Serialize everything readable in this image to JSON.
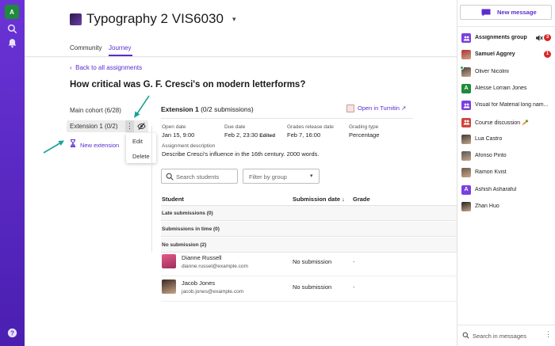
{
  "rail": {
    "avatar_letter": "A"
  },
  "course": {
    "title": "Typography 2 VIS6030"
  },
  "tabs": [
    {
      "label": "Community"
    },
    {
      "label": "Journey"
    }
  ],
  "back_link": "Back to all assignments",
  "question": "How critical was G. F. Cresci's on modern letterforms?",
  "left_panel": {
    "cohort": "Main cohort (6/28)",
    "extension": "Extension 1 (0/2)",
    "menu": {
      "edit": "Edit",
      "delete": "Delete"
    },
    "new_extension": "New extension"
  },
  "panel": {
    "title_bold": "Extension 1",
    "title_rest": " (0/2 submissions)",
    "turnitin": "Open in Turnitin",
    "open_date": {
      "label": "Open date",
      "value": "Jan 15, 9:00"
    },
    "due_date": {
      "label": "Due date",
      "value": "Feb 2, 23:30",
      "tag": "Edited"
    },
    "grades_release": {
      "label": "Grades release date",
      "value": "Feb 7, 16:00"
    },
    "grading_type": {
      "label": "Grading type",
      "value": "Percentage"
    },
    "description": {
      "label": "Assignment description",
      "value": "Describe Cresci's influence in the 16th century. 2000 words."
    },
    "search_placeholder": "Search students",
    "filter_placeholder": "Filter by group",
    "columns": {
      "student": "Student",
      "submission_date": "Submission date ↓",
      "grade": "Grade"
    },
    "sections": {
      "late": "Late submissions (0)",
      "on_time": "Submissions in time (0)",
      "none": "No submission (2)"
    },
    "students": [
      {
        "name": "Dianne Russell",
        "email": "dianne.russel@example.com",
        "status": "No submission",
        "grade": "-"
      },
      {
        "name": "Jacob Jones",
        "email": "jacob.jones@example.com",
        "status": "No submission",
        "grade": "-"
      }
    ]
  },
  "chat": {
    "new_message": "New message",
    "items": [
      {
        "name": "Assignments group",
        "bold": true,
        "badge": "3",
        "muted": true,
        "avatar": "group",
        "color": "#7a3fe0"
      },
      {
        "name": "Samuel Aggrey",
        "bold": true,
        "badge": "1",
        "avatar": "photo",
        "color": "#b03030"
      },
      {
        "name": "Oliver Nicolini",
        "avatar": "photo",
        "color": "#444444",
        "online": true
      },
      {
        "name": "Alesse Lorrain Jones",
        "avatar": "A",
        "color": "#1f8a3a"
      },
      {
        "name": "Visual for Material long nam...",
        "avatar": "group",
        "color": "#7a3fe0"
      },
      {
        "name": "Course discussion 🥕",
        "avatar": "group",
        "color": "#d0443a"
      },
      {
        "name": "Lua Castro",
        "avatar": "photo",
        "color": "#3a3a3a"
      },
      {
        "name": "Afonso Pinto",
        "avatar": "photo",
        "color": "#555555"
      },
      {
        "name": "Ramon Kvist",
        "avatar": "photo",
        "color": "#6a5a4a"
      },
      {
        "name": "Ashish Asharaful",
        "avatar": "A",
        "color": "#7a3fe0"
      },
      {
        "name": "Zhan Huo",
        "avatar": "photo",
        "color": "#222222"
      }
    ],
    "search_placeholder": "Search in messages"
  }
}
